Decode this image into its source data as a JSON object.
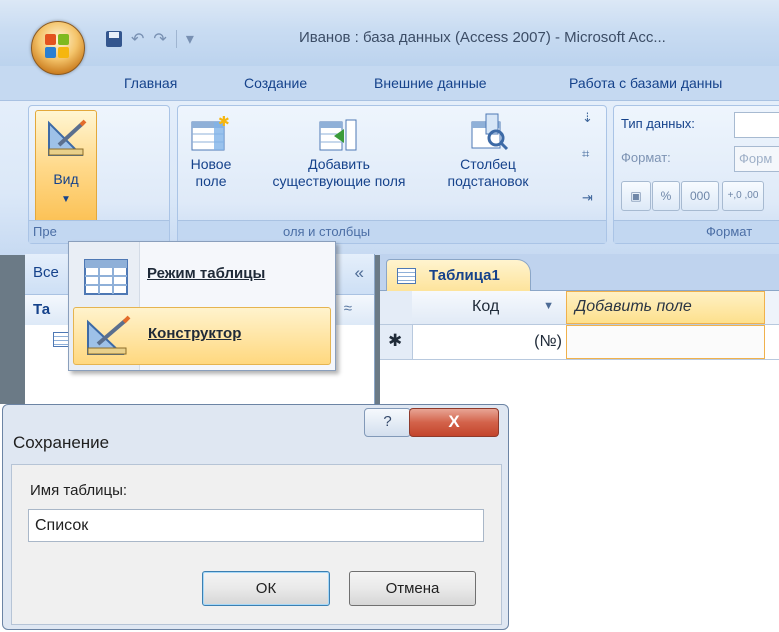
{
  "window": {
    "title": "Иванов : база данных (Access 2007) - Microsoft Acc..."
  },
  "ribbon_tabs": [
    "Главная",
    "Создание",
    "Внешние данные",
    "Работа с базами данны"
  ],
  "ribbon": {
    "view_button": "Вид",
    "view_group_label": "Пре",
    "new_field": [
      "Новое",
      "поле"
    ],
    "add_existing": [
      "Добавить",
      "существующие поля"
    ],
    "lookup_column": [
      "Столбец",
      "подстановок"
    ],
    "fields_group_label": "оля и столбцы",
    "data_type_label": "Тип данных:",
    "format_label": "Формат:",
    "format_combo_text": "Форм",
    "format_group_label": "Формат",
    "num_buttons": [
      "%",
      "000",
      "+,0 ,00"
    ]
  },
  "view_menu": {
    "items": [
      "Режим таблицы",
      "Конструктор"
    ],
    "highlighted": "Конструктор"
  },
  "nav_pane": {
    "header": "Все",
    "group": "Та",
    "collapse_glyph": "«",
    "group_chevron": "≈"
  },
  "datasheet": {
    "tab_title": "Таблица1",
    "columns": [
      "Код",
      "Добавить поле"
    ],
    "new_row_marker": "✱",
    "new_row_value": "(№)"
  },
  "dialog": {
    "title": "Сохранение",
    "help_glyph": "?",
    "close_glyph": "X",
    "label": "Имя таблицы:",
    "input_value": "Список",
    "ok_label": "ОК",
    "cancel_label": "Отмена"
  },
  "colors": {
    "ribbon_text": "#15428b",
    "highlight": "#fde08d",
    "close_red": "#c3452c"
  }
}
